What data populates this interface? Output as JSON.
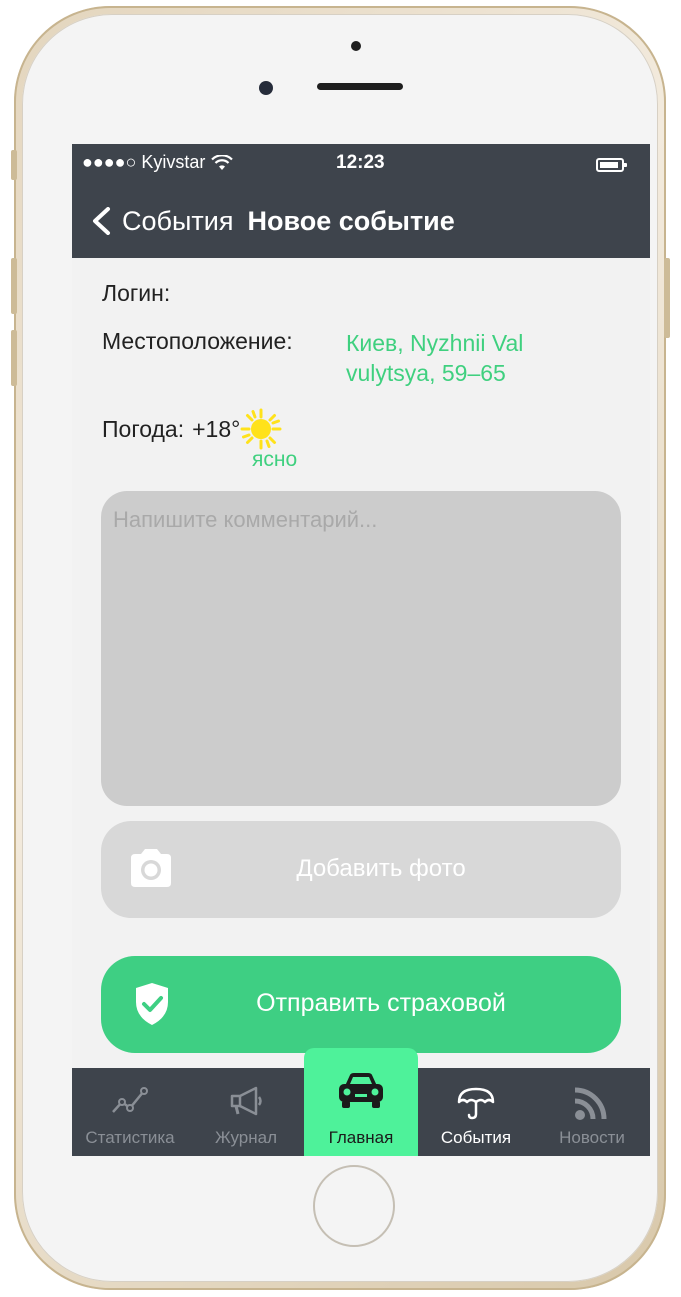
{
  "status_bar": {
    "carrier": "●●●●○ Kyivstar",
    "time": "12:23"
  },
  "nav": {
    "back_label": "События",
    "title": "Новое событие"
  },
  "form": {
    "login_label": "Логин:",
    "location_label": "Местоположение:",
    "location_value": "Киев, Nyzhnii Val vulytsya, 59–65",
    "weather_label": "Погода:",
    "temperature": "+18°",
    "weather_condition": "ясно",
    "comment_placeholder": "Напишите комментарий...",
    "add_photo_label": "Добавить фото",
    "send_label": "Отправить страховой"
  },
  "tabs": [
    {
      "label": "Статистика",
      "icon": "chart-line-icon"
    },
    {
      "label": "Журнал",
      "icon": "megaphone-icon"
    },
    {
      "label": "Главная",
      "icon": "car-icon",
      "active": true
    },
    {
      "label": "События",
      "icon": "umbrella-icon"
    },
    {
      "label": "Новости",
      "icon": "rss-icon"
    }
  ],
  "colors": {
    "bar": "#3e444c",
    "accent_green": "#3ecf83",
    "active_tab": "#4ef29a",
    "location_text": "#3fd07f"
  }
}
